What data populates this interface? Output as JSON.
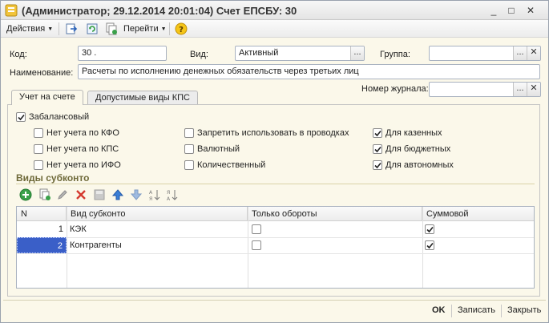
{
  "window": {
    "title": "(Администратор; 29.12.2014 20:01:04) Счет ЕПСБУ: 30",
    "controls": {
      "minimize": "_",
      "maximize": "□",
      "close": "✕"
    }
  },
  "toolbar": {
    "actions_label": "Действия",
    "goto_label": "Перейти",
    "icons": [
      "post-icon",
      "refresh-icon",
      "copy-icon",
      "help-icon"
    ]
  },
  "form": {
    "code_label": "Код:",
    "code_value": "30 .",
    "kind_label": "Вид:",
    "kind_value": "Активный",
    "group_label": "Группа:",
    "group_value": "",
    "name_label": "Наименование:",
    "name_value": "Расчеты по исполнению денежных обязательств через третьих лиц",
    "journal_label": "Номер журнала:",
    "journal_value": "",
    "select_button": "...",
    "clear_button": "✕"
  },
  "tabs": [
    {
      "label": "Учет на счете",
      "active": true
    },
    {
      "label": "Допустимые виды КПС",
      "active": false
    }
  ],
  "options": {
    "off_balance": {
      "label": "Забалансовый",
      "checked": true
    },
    "col1": [
      {
        "label": "Нет учета по КФО",
        "checked": false
      },
      {
        "label": "Нет учета по КПС",
        "checked": false
      },
      {
        "label": "Нет учета по ИФО",
        "checked": false
      }
    ],
    "col2": [
      {
        "label": "Запретить использовать в проводках",
        "checked": false
      },
      {
        "label": "Валютный",
        "checked": false
      },
      {
        "label": "Количественный",
        "checked": false
      }
    ],
    "col3": [
      {
        "label": "Для казенных",
        "checked": true
      },
      {
        "label": "Для бюджетных",
        "checked": true
      },
      {
        "label": "Для автономных",
        "checked": true
      }
    ]
  },
  "subconto": {
    "title": "Виды субконто",
    "toolbar_icons": [
      "add-icon",
      "copy-row-icon",
      "edit-icon",
      "delete-icon",
      "save-icon",
      "move-up-icon",
      "move-down-icon",
      "sort-asc-icon",
      "sort-desc-icon"
    ],
    "columns": [
      "N",
      "Вид субконто",
      "Только обороты",
      "Суммовой"
    ],
    "rows": [
      {
        "n": "1",
        "kind": "КЭК",
        "turnover_only": false,
        "sum": true
      },
      {
        "n": "2",
        "kind": "Контрагенты",
        "turnover_only": false,
        "sum": true
      }
    ]
  },
  "footer": {
    "ok_label": "OK",
    "save_label": "Записать",
    "close_label": "Закрыть"
  },
  "colors": {
    "form_background": "#fbf8ea",
    "section_title": "#6f6a3a",
    "selected_cell": "#3a5fc8"
  }
}
